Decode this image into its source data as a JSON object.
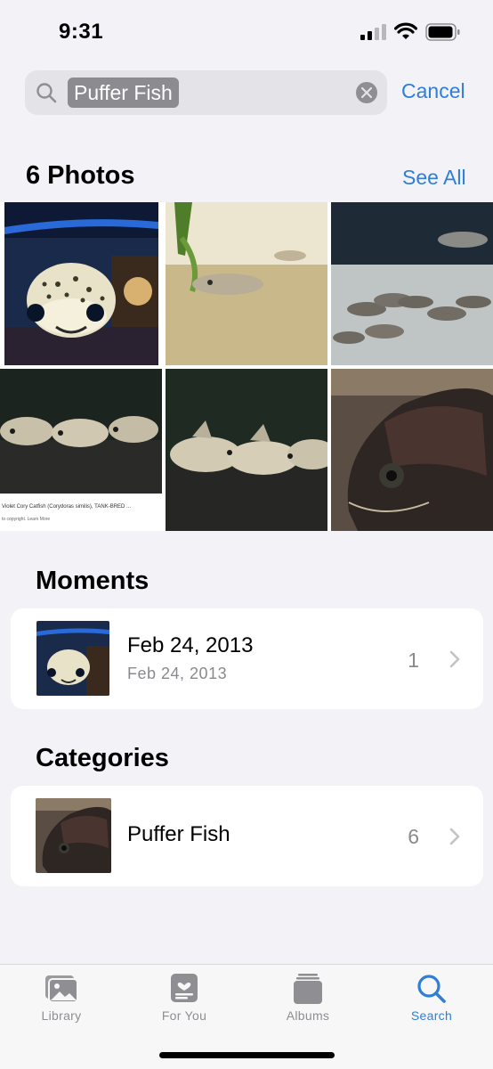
{
  "status_bar": {
    "time": "9:31"
  },
  "search": {
    "query": "Puffer Fish",
    "cancel_label": "Cancel"
  },
  "photos": {
    "title": "6 Photos",
    "see_all_label": "See All",
    "tiles": [
      {
        "name": "photo-pufferfish-tank"
      },
      {
        "name": "photo-catfish-sand"
      },
      {
        "name": "photo-cory-group"
      },
      {
        "name": "photo-cory-catfish-web",
        "caption": "Violet Cory Catfish (Corydoras similis), TANK-BRED ...",
        "subcaption": "to copyright. Learn More"
      },
      {
        "name": "photo-cory-catfish-closeup"
      },
      {
        "name": "photo-turtle-head"
      }
    ]
  },
  "moments": {
    "title": "Moments",
    "items": [
      {
        "title": "Feb 24, 2013",
        "subtitle": "Feb 24, 2013",
        "count": "1"
      }
    ]
  },
  "categories": {
    "title": "Categories",
    "items": [
      {
        "title": "Puffer Fish",
        "count": "6"
      }
    ]
  },
  "tab_bar": {
    "tabs": [
      {
        "label": "Library",
        "icon": "library-icon",
        "active": false
      },
      {
        "label": "For You",
        "icon": "for-you-icon",
        "active": false
      },
      {
        "label": "Albums",
        "icon": "albums-icon",
        "active": false
      },
      {
        "label": "Search",
        "icon": "search-icon",
        "active": true
      }
    ]
  },
  "colors": {
    "accent": "#2f7ed8",
    "background": "#f2f2f7",
    "secondary_text": "#8a8a8e"
  }
}
